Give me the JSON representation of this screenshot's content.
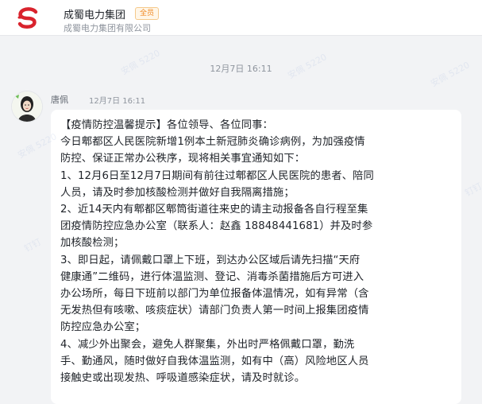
{
  "header": {
    "org_name": "成蜀电力集团",
    "badge": "全员",
    "subtitle": "成蜀电力集团有限公司"
  },
  "chat": {
    "date_separator": "12月7日  16:11",
    "message": {
      "sender": "唐佩",
      "time": "12月7日  16:11",
      "lines": [
        "【疫情防控温馨提示】各位领导、各位同事：",
        "今日郫都区人民医院新增1例本土新冠肺炎确诊病例，为加强疫情",
        "防控、保证正常办公秩序，现将相关事宜通知如下：",
        "1、12月6日至12月7日期间有前往过郫都区人民医院的患者、陪同",
        "人员，请及时参加核酸检测并做好自我隔离措施；",
        "2、近14天内有郫都区郫筒街道往来史的请主动报备各自行程至集",
        "团疫情防控应急办公室（联系人：赵鑫 18848441681）并及时参",
        "加核酸检测；",
        "3、即日起，请佩戴口罩上下班，到达办公区域后请先扫描“天府",
        "健康通”二维码，进行体温监测、登记、消毒杀菌措施后方可进入",
        "办公场所，每日下班前以部门为单位报备体温情况，如有异常（含",
        "无发热但有咳嗽、咳痰症状）请部门负责人第一时间上报集团疫情",
        "防控应急办公室；",
        "4、减少外出聚会，避免人群聚集，外出时严格佩戴口罩，勤洗",
        "手、勤通风，随时做好自我体温监测，如有中（高）风险地区人员",
        "接触史或出现发热、呼吸道感染症状，请及时就诊。"
      ]
    }
  },
  "watermark": {
    "text": "安佩 5220",
    "text_short": "钉钉"
  },
  "colors": {
    "logo_red": "#d9232d",
    "badge_orange": "#f08a24",
    "background": "#f2f3f5"
  },
  "icons": {
    "logo": "company-logo-icon",
    "avatar": "user-avatar"
  }
}
